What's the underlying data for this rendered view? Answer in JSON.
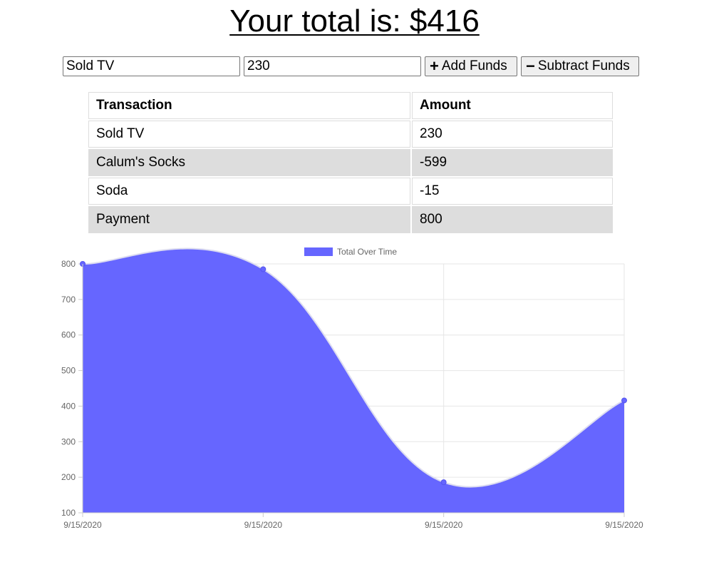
{
  "header": {
    "total_text": "Your total is: $416"
  },
  "form": {
    "name_value": "Sold TV",
    "amount_value": "230",
    "add_label": "Add Funds",
    "add_icon": "plus-icon",
    "subtract_label": "Subtract Funds",
    "subtract_icon": "minus-icon"
  },
  "table": {
    "headers": [
      "Transaction",
      "Amount"
    ],
    "rows": [
      {
        "name": "Sold TV",
        "amount": "230"
      },
      {
        "name": "Calum's Socks",
        "amount": "-599"
      },
      {
        "name": "Soda",
        "amount": "-15"
      },
      {
        "name": "Payment",
        "amount": "800"
      }
    ]
  },
  "chart_data": {
    "type": "area",
    "title": "",
    "legend": {
      "label": "Total Over Time",
      "position": "top"
    },
    "x": [
      "9/15/2020",
      "9/15/2020",
      "9/15/2020",
      "9/15/2020"
    ],
    "series": [
      {
        "name": "Total Over Time",
        "values": [
          800,
          785,
          186,
          416
        ],
        "color": "#6666ff"
      }
    ],
    "ylim": [
      100,
      800
    ],
    "yticks": [
      100,
      200,
      300,
      400,
      500,
      600,
      700,
      800
    ],
    "grid": true,
    "xlabel": "",
    "ylabel": ""
  }
}
